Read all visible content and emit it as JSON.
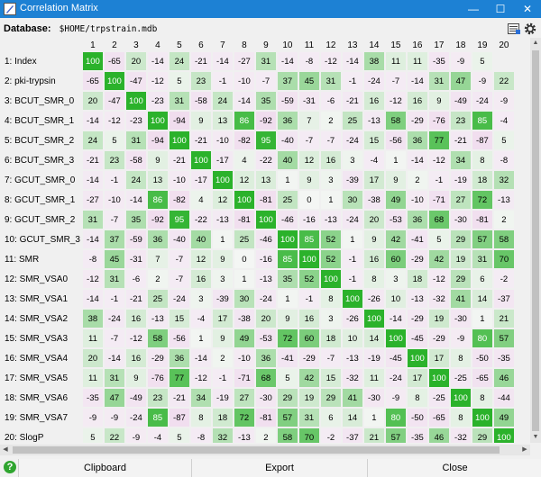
{
  "window": {
    "title": "Correlation Matrix",
    "minimize": "—",
    "maximize": "☐",
    "close": "✕"
  },
  "database": {
    "label": "Database:",
    "path": "$HOME/trpstrain.mdb"
  },
  "columns": [
    "1",
    "2",
    "3",
    "4",
    "5",
    "6",
    "7",
    "8",
    "9",
    "10",
    "11",
    "12",
    "13",
    "14",
    "15",
    "16",
    "17",
    "18",
    "19",
    "20"
  ],
  "rows": [
    {
      "label": "1: Index",
      "values": [
        100,
        -65,
        20,
        -14,
        24,
        -21,
        -14,
        -27,
        31,
        -14,
        -8,
        -12,
        -14,
        38,
        11,
        11,
        -35,
        -9,
        5
      ]
    },
    {
      "label": "2: pki-trypsin",
      "values": [
        -65,
        100,
        -47,
        -12,
        5,
        23,
        -1,
        -10,
        -7,
        37,
        45,
        31,
        -1,
        -24,
        -7,
        -14,
        31,
        47,
        -9,
        22
      ]
    },
    {
      "label": "3: BCUT_SMR_0",
      "values": [
        20,
        -47,
        100,
        -23,
        31,
        -58,
        24,
        -14,
        35,
        -59,
        -31,
        -6,
        -21,
        16,
        -12,
        16,
        9,
        -49,
        -24,
        -9
      ]
    },
    {
      "label": "4: BCUT_SMR_1",
      "values": [
        -14,
        -12,
        -23,
        100,
        -94,
        9,
        13,
        86,
        -92,
        36,
        7,
        2,
        25,
        -13,
        58,
        -29,
        -76,
        23,
        85,
        -4
      ]
    },
    {
      "label": "5: BCUT_SMR_2",
      "values": [
        24,
        5,
        31,
        -94,
        100,
        -21,
        -10,
        -82,
        95,
        -40,
        -7,
        -7,
        -24,
        15,
        -56,
        36,
        77,
        -21,
        -87,
        5
      ]
    },
    {
      "label": "6: BCUT_SMR_3",
      "values": [
        -21,
        23,
        -58,
        9,
        -21,
        100,
        -17,
        4,
        -22,
        40,
        12,
        16,
        3,
        -4,
        1,
        -14,
        -12,
        34,
        8,
        -8
      ]
    },
    {
      "label": "7: GCUT_SMR_0",
      "values": [
        -14,
        -1,
        24,
        13,
        -10,
        -17,
        100,
        12,
        13,
        1,
        9,
        3,
        -39,
        17,
        9,
        2,
        -1,
        -19,
        18,
        32
      ]
    },
    {
      "label": "8: GCUT_SMR_1",
      "values": [
        -27,
        -10,
        -14,
        86,
        -82,
        4,
        12,
        100,
        -81,
        25,
        0,
        1,
        30,
        -38,
        49,
        -10,
        -71,
        27,
        72,
        -13
      ]
    },
    {
      "label": "9: GCUT_SMR_2",
      "values": [
        31,
        -7,
        35,
        -92,
        95,
        -22,
        -13,
        -81,
        100,
        -46,
        -16,
        -13,
        -24,
        20,
        -53,
        36,
        68,
        -30,
        -81,
        2
      ]
    },
    {
      "label": "10: GCUT_SMR_3",
      "values": [
        -14,
        37,
        -59,
        36,
        -40,
        40,
        1,
        25,
        -46,
        100,
        85,
        52,
        1,
        9,
        42,
        -41,
        5,
        29,
        57,
        58
      ]
    },
    {
      "label": "11: SMR",
      "values": [
        -8,
        45,
        -31,
        7,
        -7,
        12,
        9,
        0,
        -16,
        85,
        100,
        52,
        -1,
        16,
        60,
        -29,
        42,
        19,
        31,
        70
      ]
    },
    {
      "label": "12: SMR_VSA0",
      "values": [
        -12,
        31,
        -6,
        2,
        -7,
        16,
        3,
        1,
        -13,
        35,
        52,
        100,
        -1,
        8,
        3,
        18,
        -12,
        29,
        6,
        -2
      ]
    },
    {
      "label": "13: SMR_VSA1",
      "values": [
        -14,
        -1,
        -21,
        25,
        -24,
        3,
        -39,
        30,
        -24,
        1,
        -1,
        8,
        100,
        -26,
        10,
        -13,
        -32,
        41,
        14,
        -37
      ]
    },
    {
      "label": "14: SMR_VSA2",
      "values": [
        38,
        -24,
        16,
        -13,
        15,
        -4,
        17,
        -38,
        20,
        9,
        16,
        3,
        -26,
        100,
        -14,
        -29,
        19,
        -30,
        1,
        21
      ]
    },
    {
      "label": "15: SMR_VSA3",
      "values": [
        11,
        -7,
        -12,
        58,
        -56,
        1,
        9,
        49,
        -53,
        72,
        60,
        18,
        10,
        14,
        100,
        -45,
        -29,
        -9,
        80,
        57
      ]
    },
    {
      "label": "16: SMR_VSA4",
      "values": [
        20,
        -14,
        16,
        -29,
        36,
        -14,
        2,
        -10,
        36,
        -41,
        -29,
        -7,
        -13,
        -19,
        -45,
        100,
        17,
        8,
        -50,
        -35
      ]
    },
    {
      "label": "17: SMR_VSA5",
      "values": [
        11,
        31,
        9,
        -76,
        77,
        -12,
        -1,
        -71,
        68,
        5,
        42,
        15,
        -32,
        11,
        -24,
        17,
        100,
        -25,
        -65,
        46
      ]
    },
    {
      "label": "18: SMR_VSA6",
      "values": [
        -35,
        47,
        -49,
        23,
        -21,
        34,
        -19,
        27,
        -30,
        29,
        19,
        29,
        41,
        -30,
        -9,
        8,
        -25,
        100,
        8,
        -44
      ]
    },
    {
      "label": "19: SMR_VSA7",
      "values": [
        -9,
        -9,
        -24,
        85,
        -87,
        8,
        18,
        72,
        -81,
        57,
        31,
        6,
        14,
        1,
        80,
        -50,
        -65,
        8,
        100,
        49
      ]
    },
    {
      "label": "20: SlogP",
      "values": [
        5,
        22,
        -9,
        -4,
        5,
        -8,
        32,
        -13,
        2,
        58,
        70,
        -2,
        -37,
        21,
        57,
        -35,
        46,
        -32,
        29,
        100
      ]
    }
  ],
  "buttons": {
    "clipboard": "Clipboard",
    "export": "Export",
    "close": "Close",
    "help": "?"
  },
  "colors": {
    "titlebar": "#1d81d4",
    "positive_max": "#2bb22b",
    "negative": "#f4e9f4"
  }
}
